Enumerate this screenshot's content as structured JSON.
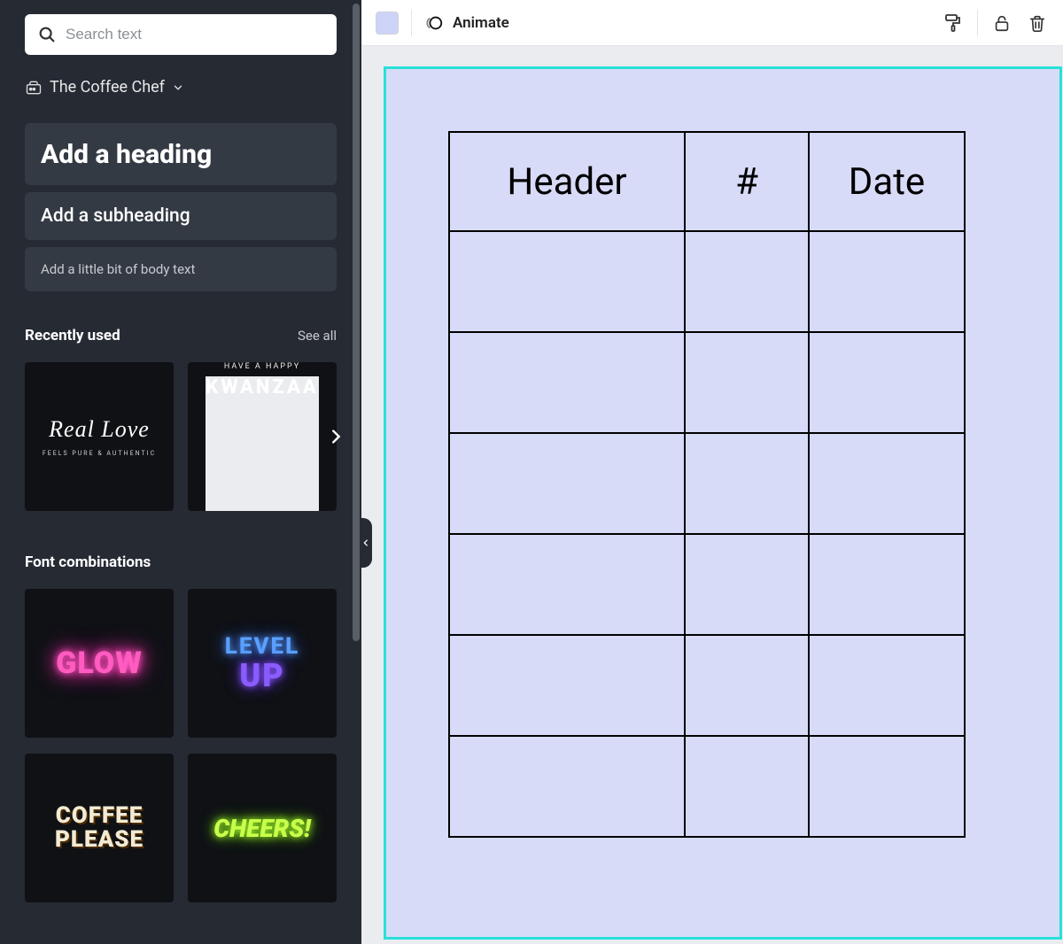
{
  "sidebar": {
    "search_placeholder": "Search text",
    "brand_label": "The Coffee Chef",
    "add_heading": "Add a heading",
    "add_subheading": "Add a subheading",
    "add_body": "Add a little bit of body text",
    "recently_used_title": "Recently used",
    "see_all": "See all",
    "font_combos_title": "Font combinations",
    "recent": [
      {
        "line1": "Real Love",
        "line2": "FEELS PURE & AUTHENTIC"
      },
      {
        "sup": "HAVE A HAPPY",
        "main": "KWANZAA"
      }
    ],
    "combos": [
      {
        "label": "GLOW"
      },
      {
        "l1": "LEVEL",
        "l2": "UP"
      },
      {
        "l1": "COFFEE",
        "l2": "PLEASE"
      },
      {
        "label": "CHEERS!"
      }
    ]
  },
  "topbar": {
    "swatch_color": "#CED4F7",
    "animate_label": "Animate"
  },
  "table": {
    "headers": [
      "Header",
      "#",
      "Date"
    ],
    "body_rows": 6
  }
}
